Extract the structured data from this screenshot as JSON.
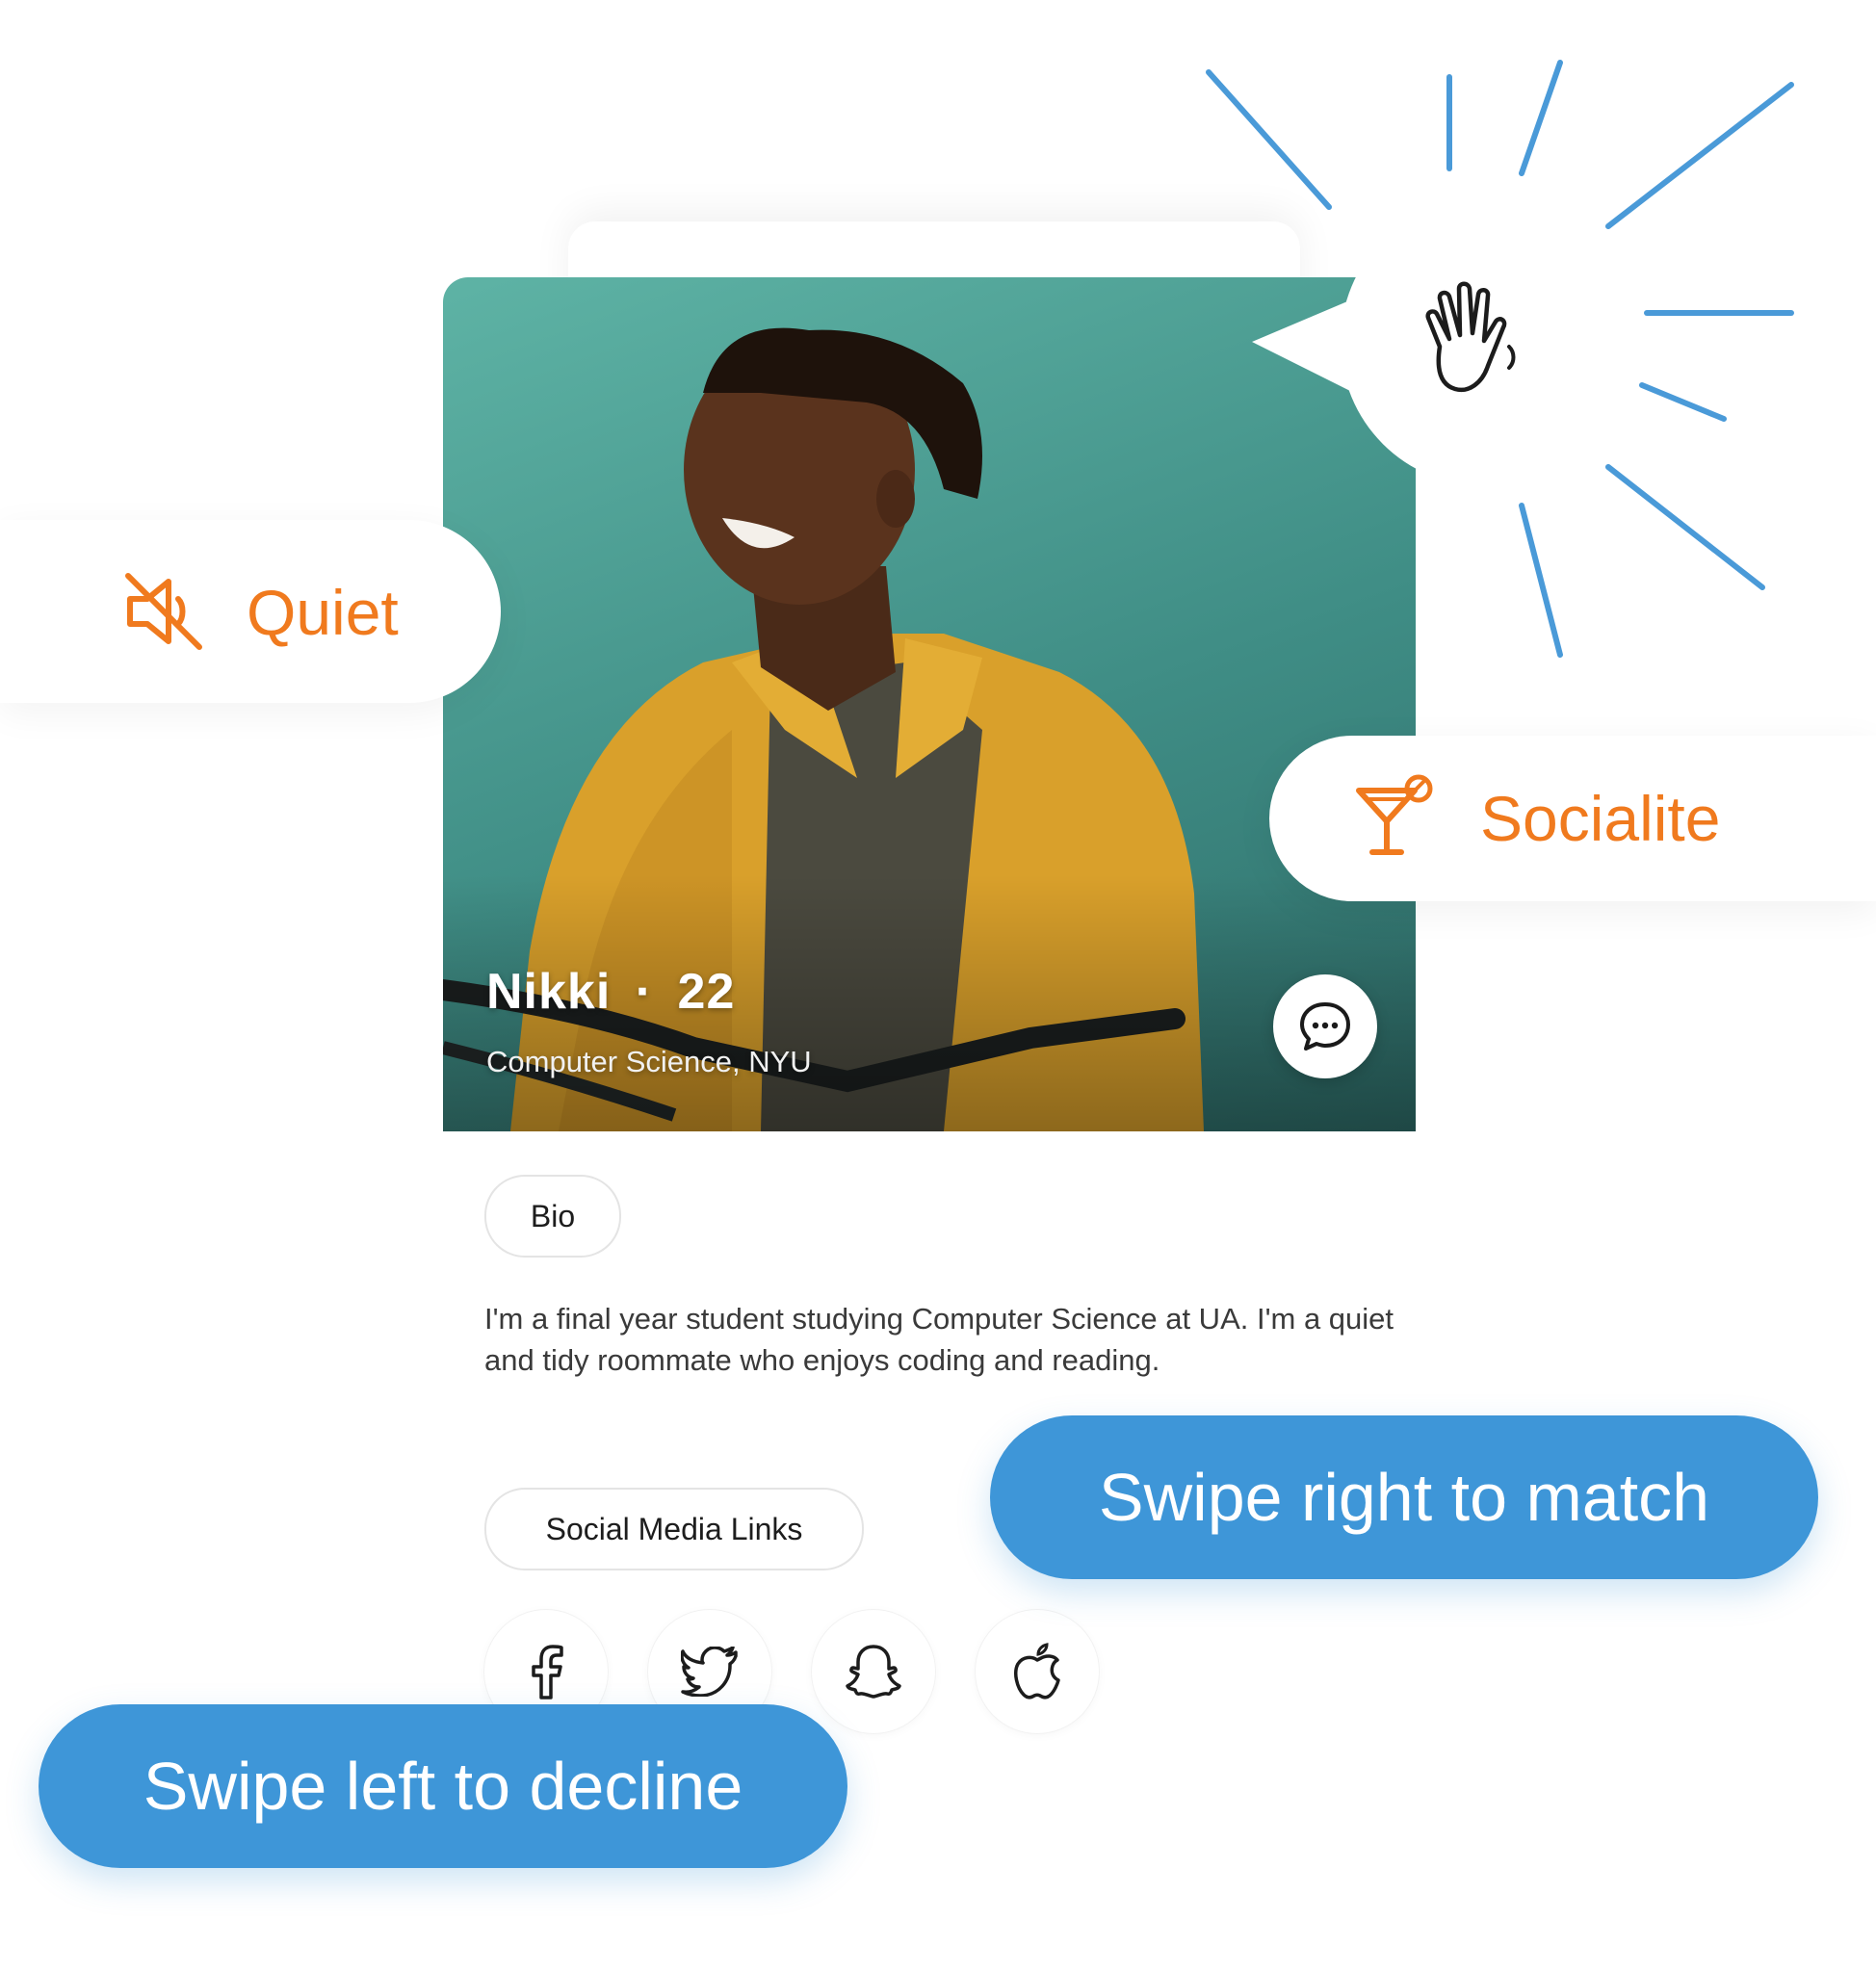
{
  "profile": {
    "name": "Nikki",
    "separator": "·",
    "age": "22",
    "subtitle": "Computer Science, NYU"
  },
  "bio": {
    "label": "Bio",
    "text": "I'm a final year student studying Computer Science at UA. I'm a quiet and tidy roommate who enjoys coding and reading."
  },
  "social": {
    "label": "Social Media Links",
    "icons": [
      "facebook-icon",
      "twitter-icon",
      "snapchat-icon",
      "apple-icon"
    ]
  },
  "traits": {
    "left": {
      "label": "Quiet",
      "icon": "muted-speaker-icon"
    },
    "right": {
      "label": "Socialite",
      "icon": "cocktail-icon"
    }
  },
  "wave": {
    "icon": "waving-hand-icon"
  },
  "actions": {
    "swipe_right": "Swipe right to match",
    "swipe_left": "Swipe left to decline"
  },
  "colors": {
    "accent_blue": "#3e96d8",
    "trait_orange": "#f07a1e",
    "photo_teal": "#4a9e95",
    "ray_blue": "#4a9ad8"
  }
}
